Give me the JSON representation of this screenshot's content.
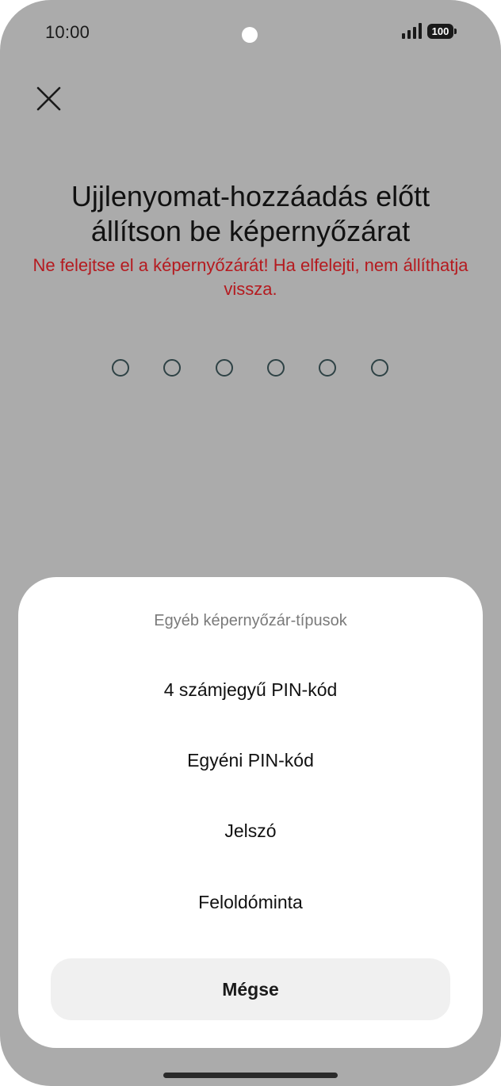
{
  "status_bar": {
    "time": "10:00",
    "battery": "100",
    "icons": [
      "signal-icon",
      "battery-icon"
    ]
  },
  "header": {
    "close_icon": "close-icon"
  },
  "main": {
    "title": "Ujjlenyomat-hozzáadás előtt állítson be képernyőzárat",
    "warning": "Ne felejtse el a képernyőzárát! Ha elfelejti, nem állíthatja vissza.",
    "pin_length": 6
  },
  "sheet": {
    "title": "Egyéb képernyőzár-típusok",
    "options": [
      {
        "label": "4 számjegyű PIN-kód"
      },
      {
        "label": "Egyéni PIN-kód"
      },
      {
        "label": "Jelszó"
      },
      {
        "label": "Feloldóminta"
      }
    ],
    "cancel_label": "Mégse"
  },
  "colors": {
    "scrim": "#ababab",
    "warning": "#b51a1f",
    "pin_dot_border": "#2e4245",
    "sheet_background": "#ffffff",
    "cancel_background": "#f0f0f0"
  }
}
